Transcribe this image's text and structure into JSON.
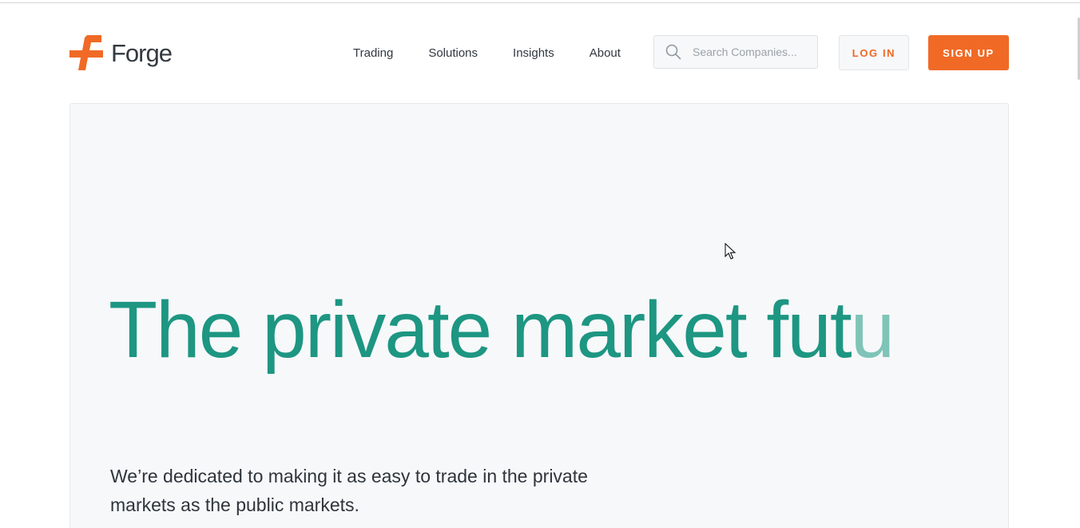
{
  "brand": {
    "name": "Forge",
    "accent_color": "#f06a26",
    "teal_color": "#1d9682",
    "logo_icon": "forge-logo-icon"
  },
  "nav": {
    "items": [
      {
        "label": "Trading"
      },
      {
        "label": "Solutions"
      },
      {
        "label": "Insights"
      },
      {
        "label": "About"
      }
    ]
  },
  "search": {
    "placeholder": "Search Companies...",
    "value": "",
    "icon": "search-icon"
  },
  "actions": {
    "login_label": "LOG IN",
    "signup_label": "SIGN UP"
  },
  "hero": {
    "title_main": "The private market fut",
    "title_fade": "u",
    "subtitle": "We’re dedicated to making it as easy to trade in the private markets as the public markets."
  }
}
